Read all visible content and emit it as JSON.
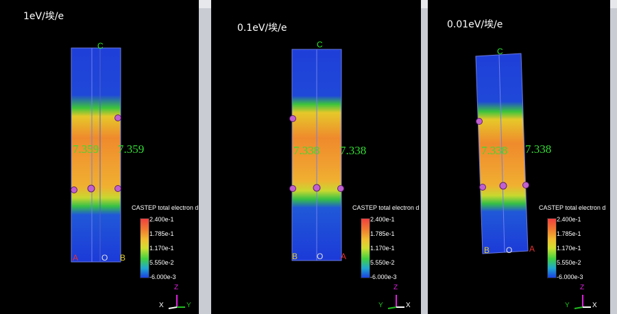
{
  "panels": [
    {
      "title": "1eV/埃/e",
      "bond_left": "7.359",
      "bond_right": "7.359",
      "top_axis": "C",
      "bl_axis": "A",
      "bm_axis": "O",
      "br_axis": "B",
      "triad": {
        "v": "Z",
        "l": "X",
        "r": "Y"
      }
    },
    {
      "title": "0.1eV/埃/e",
      "bond_left": "7.338",
      "bond_right": "7.338",
      "top_axis": "C",
      "bl_axis": "B",
      "bm_axis": "O",
      "br_axis": "A",
      "triad": {
        "v": "Z",
        "l": "Y",
        "r": "X"
      }
    },
    {
      "title": "0.01eV/埃/e",
      "bond_left": "7.338",
      "bond_right": "7.338",
      "top_axis": "C",
      "bl_axis": "B",
      "bm_axis": "O",
      "br_axis": "A",
      "triad": {
        "v": "Z",
        "l": "Y",
        "r": "X"
      }
    }
  ],
  "legend": {
    "title": "CASTEP total electron d",
    "ticks": [
      "2.400e-1",
      "1.785e-1",
      "1.170e-1",
      "5.550e-2",
      "-6.000e-3"
    ]
  },
  "colors": {
    "axis_green": "#2ee82e",
    "axis_yellow": "#e8d020",
    "axis_red": "#e83030",
    "triad_magenta": "#e020e0",
    "triad_green": "#20c020"
  }
}
